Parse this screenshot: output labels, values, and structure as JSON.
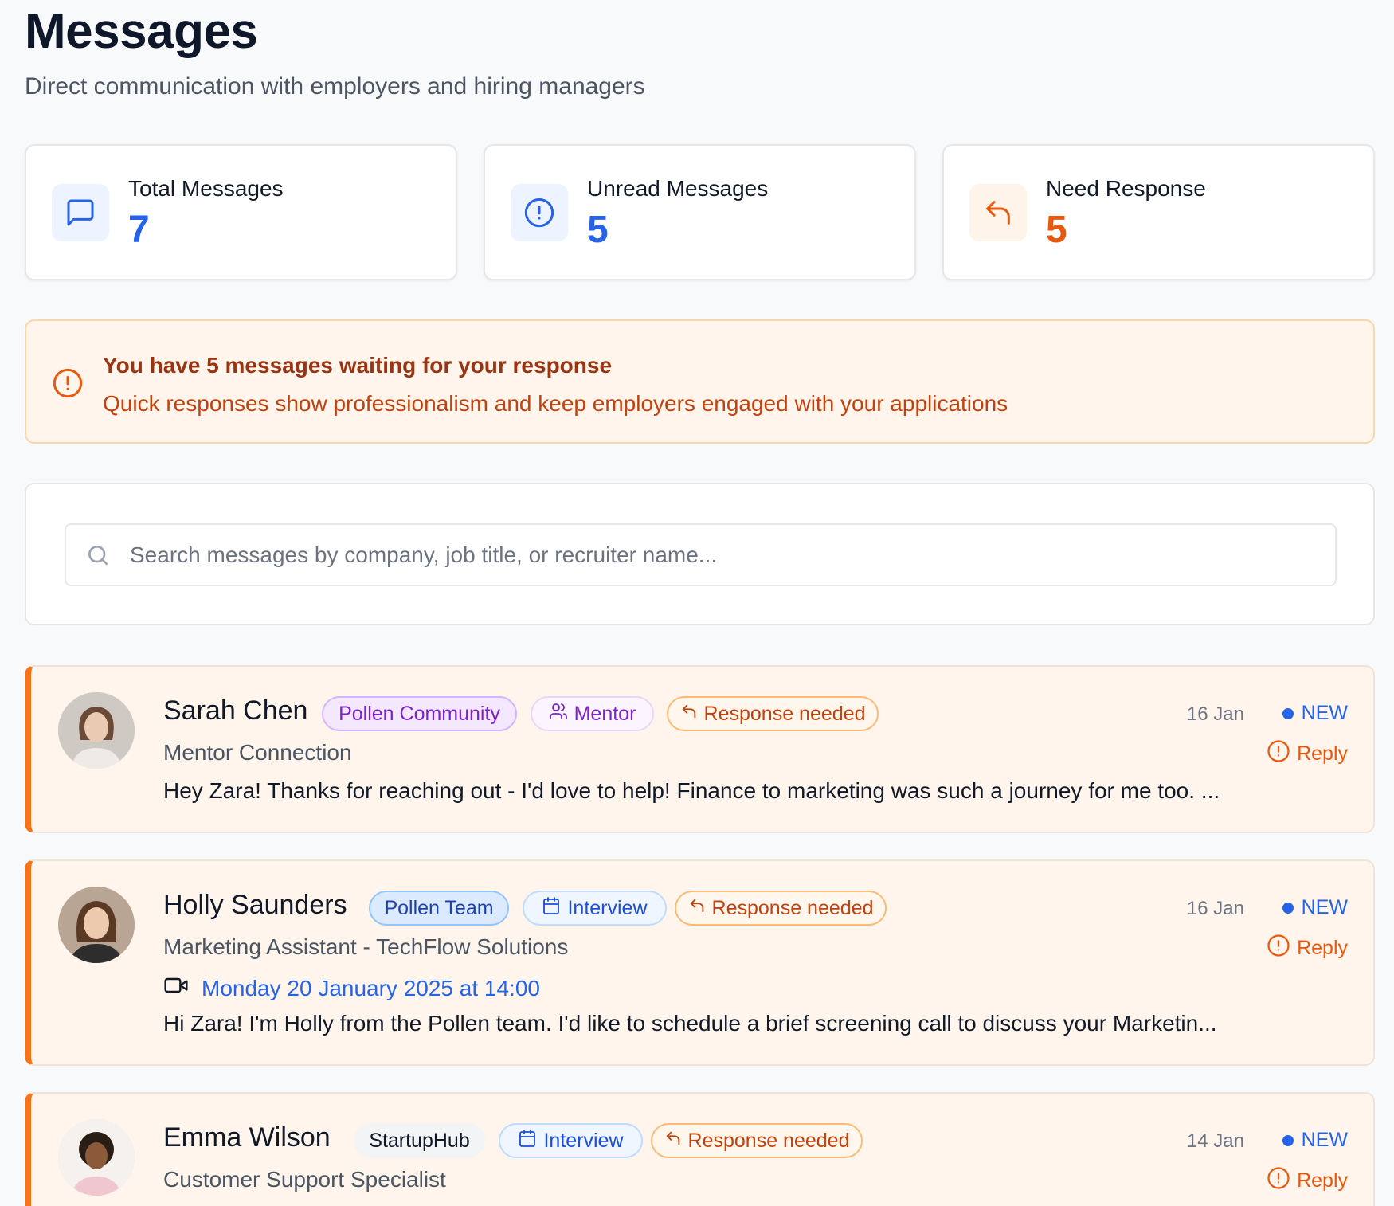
{
  "page": {
    "title": "Messages",
    "subtitle": "Direct communication with employers and hiring managers"
  },
  "stats": [
    {
      "label": "Total Messages",
      "value": "7",
      "icon": "message-square-icon",
      "color": "#2563eb"
    },
    {
      "label": "Unread Messages",
      "value": "5",
      "icon": "alert-circle-icon",
      "color": "#2563eb"
    },
    {
      "label": "Need Response",
      "value": "5",
      "icon": "reply-icon",
      "color": "#ea580c"
    }
  ],
  "alert": {
    "title": "You have 5 messages waiting for your response",
    "text": "Quick responses show professionalism and keep employers engaged with your applications"
  },
  "search": {
    "placeholder": "Search messages by company, job title, or recruiter name...",
    "value": ""
  },
  "messages": [
    {
      "name": "Sarah Chen",
      "source": "Pollen Community",
      "type": "Mentor",
      "status": "Response needed",
      "date": "16 Jan",
      "badge": "NEW",
      "action": "Reply",
      "subject": "Mentor Connection",
      "preview": "Hey Zara! Thanks for reaching out - I'd love to help! Finance to marketing was such a journey for me too. ..."
    },
    {
      "name": "Holly Saunders",
      "source": "Pollen Team",
      "type": "Interview",
      "status": "Response needed",
      "date": "16 Jan",
      "badge": "NEW",
      "action": "Reply",
      "subject": "Marketing Assistant - TechFlow Solutions",
      "interview_time": "Monday 20 January 2025 at 14:00",
      "preview": "Hi Zara! I'm Holly from the Pollen team. I'd like to schedule a brief screening call to discuss your Marketin..."
    },
    {
      "name": "Emma Wilson",
      "source": "StartupHub",
      "type": "Interview",
      "status": "Response needed",
      "date": "14 Jan",
      "badge": "NEW",
      "action": "Reply",
      "subject": "Customer Support Specialist"
    }
  ],
  "colors": {
    "accent_blue": "#2563eb",
    "accent_orange": "#ea580c",
    "unread_border": "#f97316",
    "unread_bg": "#fff5ec"
  }
}
